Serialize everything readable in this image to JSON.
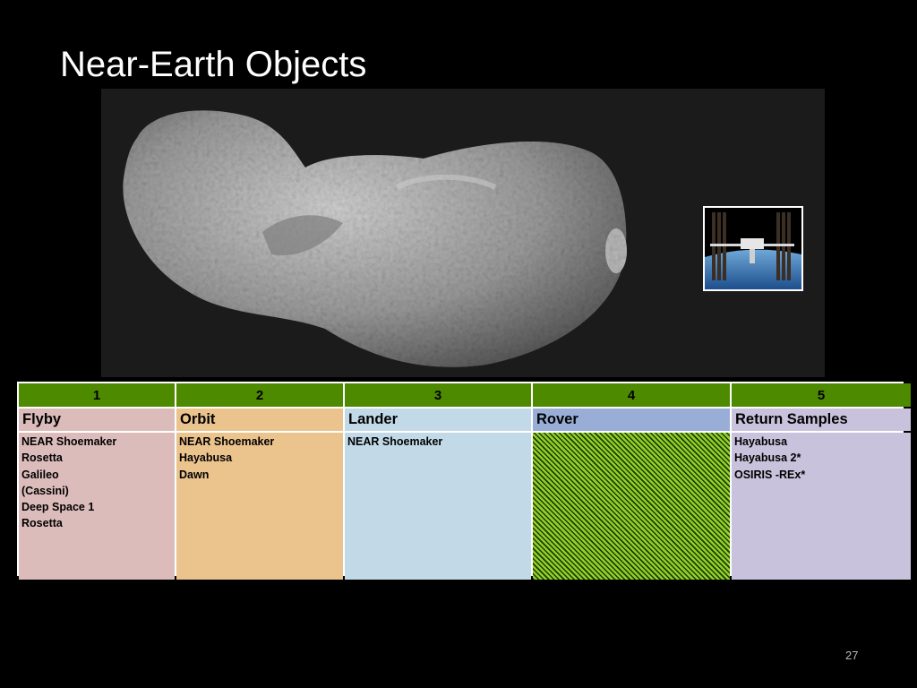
{
  "slide": {
    "title": "Near-Earth Objects",
    "page_number": "27"
  },
  "table": {
    "columns": [
      {
        "number": "1",
        "category": "Flyby",
        "missions": [
          "NEAR Shoemaker",
          "Rosetta",
          "Galileo",
          "(Cassini)",
          "Deep Space 1",
          "Rosetta"
        ]
      },
      {
        "number": "2",
        "category": "Orbit",
        "missions": [
          "NEAR Shoemaker",
          "Hayabusa",
          "Dawn"
        ]
      },
      {
        "number": "3",
        "category": "Lander",
        "missions": [
          "NEAR Shoemaker"
        ]
      },
      {
        "number": "4",
        "category": "Rover",
        "missions": []
      },
      {
        "number": "5",
        "category": "Return Samples",
        "missions": [
          "Hayabusa",
          "Hayabusa 2*",
          "OSIRIS -REx*"
        ]
      }
    ]
  },
  "colors": {
    "number_row": "#4e8a00",
    "flyby": "#dcbcbb",
    "orbit": "#ebc38d",
    "lander": "#c2d9e8",
    "rover_header": "#99aed7",
    "return_samples": "#c9c2dc"
  }
}
